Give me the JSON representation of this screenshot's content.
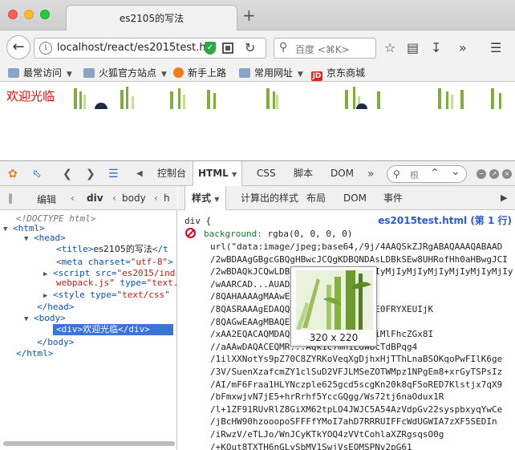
{
  "window": {
    "tab_title": "es2105的写法",
    "new_tab_icon": "+"
  },
  "nav": {
    "url": "localhost/react/es2015test.h",
    "search_placeholder": "百度 <⌘K>"
  },
  "bookmarks": [
    {
      "label": "最常访问",
      "icon": "folder-icon"
    },
    {
      "label": "火狐官方站点",
      "icon": "folder-icon"
    },
    {
      "label": "新手上路",
      "icon": "firefox-icon"
    },
    {
      "label": "常用网址",
      "icon": "folder-icon"
    },
    {
      "label": "京东商城",
      "icon": "jd-icon"
    }
  ],
  "page": {
    "welcome_text": "欢迎光临"
  },
  "devtools": {
    "tabs": [
      "控制台",
      "HTML",
      "CSS",
      "脚本",
      "DOM"
    ],
    "active_tab": "HTML",
    "search_placeholder": "根",
    "edit_label": "编辑",
    "breadcrumbs": [
      "div",
      "body",
      "h"
    ],
    "markup": [
      {
        "doctype": "<!DOCTYPE html>"
      },
      {
        "html_open": "<html>"
      },
      {
        "head_open": "<head>"
      },
      {
        "title_tag": "<title>",
        "title_text": "es2105的写法",
        "title_close": "</t"
      },
      {
        "meta_tag": "<meta",
        "meta_attr": "charset=",
        "meta_val": "\"utf-8\"",
        "meta_end": ">"
      },
      {
        "script_tag": "<script",
        "script_attr": "src=",
        "script_val": "\"es2015/ind",
        "script_val2": "webpack.js\"",
        "script_attr2": "type=",
        "script_val3": "\"text."
      },
      {
        "style_tag": "<style",
        "style_attr": "type=",
        "style_val": "\"text/css\""
      },
      {
        "head_close": "</head>"
      },
      {
        "body_open": "<body>"
      },
      {
        "div_open": "<div>",
        "div_text": "欢迎光临",
        "div_close": "</div>"
      },
      {
        "body_close": "</body>"
      },
      {
        "html_close": "</html>"
      }
    ],
    "rule_tabs": [
      "样式",
      "计算出的样式",
      "布局",
      "DOM",
      "事件"
    ],
    "active_rule_tab": "样式",
    "rule": {
      "selector": "div {",
      "source": "es2015test.html (第 1 行)",
      "prop_name": "background:",
      "prop_value": "rgba(0, 0, 0, 0)",
      "data_lines": [
        "url(\"data:image/jpeg;base64,/9j/4AAQSkZJRgABAQAAAQABAAD",
        "/2wBDAAgGBgcGBQgHBwcJCQgKDBQNDAsLDBkSEw8UHRofHh0aHBwgJCI",
        "/2wBDAQkJCQwLDBgNDRgyIRwhMjIyMjIyMjIyMjIyMjIyMjIyMjIyMjIy",
        "/wAARCAD...AUADAS...",
        "/8QAHAAAAgMAAwEB...EBQcCAwgB",
        "/8QASRAAAgEDAQQ...DAAQRBQYSITEHE0FRYXEUIjK",
        "/8QAGwEAAgMBAQE...AAgUBBgf",
        "/xAA2EQACAQMDAQ...IDBBESITFBBRMiMlFhcZGx8I",
        "//aAAwDAQACEQMR...Aqk1C7mh1LdWbcTdBPqg4",
        "/1ilXXNotYs9pZ70C8ZYRKoVeqXgDjhxHjTThLnaBSOKqoPwFIlK6ge",
        "/3V/SuenXzafcmZY1clSuD2VFJLMSeZOTWMpz1NPgEm8+xrGyTSPsIz",
        "/AI/mF6Fraa1HLYNczple625gcd5scgKn20k8qF5oRED7Klstjx7qX9",
        "/bFmxwjvN7jE5+hrRrhf5YccGQgg/Ws72tj6naOdux1R",
        "/l+1ZF91RUvRlZ8GiXM62tpLO4JWJC5A54AzVdpGv22syspbxyqYwCe",
        "/jBcHW90hzooopoSFFFfYMoI7ahD7RRRUIFFcWdUGWIA7zXF5SEDIn",
        "/iRwzV/eTLJo/WnJCyKTkYOQ4zVVtCohlaXZRgsqsO0g",
        "/+KQut8TXTH6nGLvSbMV1SwjVsEQMSPNv2pG61"
      ]
    },
    "tooltip": {
      "caption": "320 x 220"
    }
  },
  "colors": {
    "welcome": "#ee0000",
    "selected_node": "#3875d7",
    "link": "#2a5bd3"
  }
}
